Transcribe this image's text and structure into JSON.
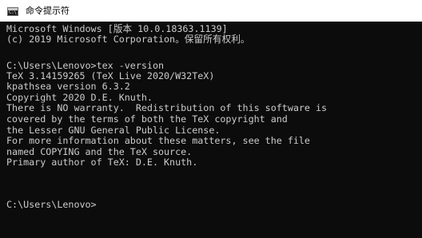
{
  "window": {
    "title": "命令提示符",
    "icon_text": "C:\\"
  },
  "console": {
    "lines": [
      "Microsoft Windows [版本 10.0.18363.1139]",
      "(c) 2019 Microsoft Corporation。保留所有权利。",
      "",
      "C:\\Users\\Lenovo>tex -version",
      "TeX 3.14159265 (TeX Live 2020/W32TeX)",
      "kpathsea version 6.3.2",
      "Copyright 2020 D.E. Knuth.",
      "There is NO warranty.  Redistribution of this software is",
      "covered by the terms of both the TeX copyright and",
      "the Lesser GNU General Public License.",
      "For more information about these matters, see the file",
      "named COPYING and the TeX source.",
      "Primary author of TeX: D.E. Knuth.",
      "",
      "C:\\Users\\Lenovo>"
    ]
  },
  "colors": {
    "console_bg": "#0c0c0c",
    "console_fg": "#cccccc",
    "titlebar_bg": "#ffffff"
  }
}
